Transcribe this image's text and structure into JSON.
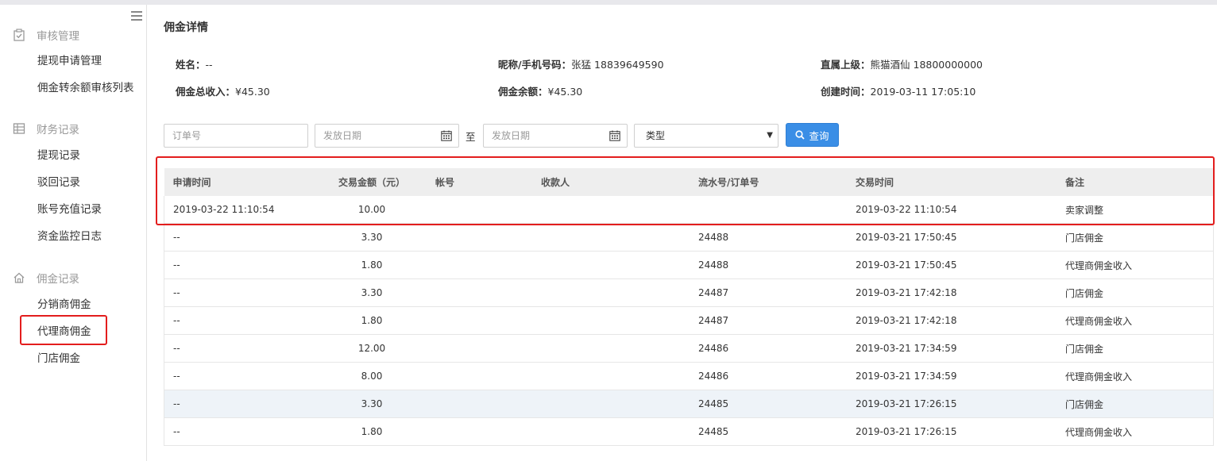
{
  "sidebar": {
    "groups": [
      {
        "title": "审核管理",
        "icon": "clipboard-check-icon",
        "items": [
          "提现申请管理",
          "佣金转余额审核列表"
        ]
      },
      {
        "title": "财务记录",
        "icon": "ledger-icon",
        "items": [
          "提现记录",
          "驳回记录",
          "账号充值记录",
          "资金监控日志"
        ]
      },
      {
        "title": "佣金记录",
        "icon": "home-icon",
        "items": [
          "分销商佣金",
          "代理商佣金",
          "门店佣金"
        ]
      }
    ],
    "active_item": "代理商佣金"
  },
  "page": {
    "title": "佣金详情"
  },
  "info": {
    "name_label": "姓名：",
    "name_value": "--",
    "nick_label": "昵称/手机号码：",
    "nick_value": "张猛  18839649590",
    "superior_label": "直属上级：",
    "superior_value": "熊猫酒仙  18800000000",
    "total_income_label": "佣金总收入：",
    "total_income_value": "¥45.30",
    "balance_label": "佣金余额：",
    "balance_value": "¥45.30",
    "created_label": "创建时间：",
    "created_value": "2019-03-11 17:05:10"
  },
  "filters": {
    "order_placeholder": "订单号",
    "start_date_placeholder": "发放日期",
    "separator": "至",
    "end_date_placeholder": "发放日期",
    "type_selected": "类型",
    "query_label": "查询"
  },
  "table": {
    "columns": [
      "申请时间",
      "交易金额（元）",
      "帐号",
      "收款人",
      "流水号/订单号",
      "交易时间",
      "备注"
    ],
    "rows": [
      [
        "2019-03-22 11:10:54",
        "10.00",
        "",
        "",
        "",
        "2019-03-22 11:10:54",
        "卖家调整"
      ],
      [
        "--",
        "3.30",
        "",
        "",
        "24488",
        "2019-03-21 17:50:45",
        "门店佣金"
      ],
      [
        "--",
        "1.80",
        "",
        "",
        "24488",
        "2019-03-21 17:50:45",
        "代理商佣金收入"
      ],
      [
        "--",
        "3.30",
        "",
        "",
        "24487",
        "2019-03-21 17:42:18",
        "门店佣金"
      ],
      [
        "--",
        "1.80",
        "",
        "",
        "24487",
        "2019-03-21 17:42:18",
        "代理商佣金收入"
      ],
      [
        "--",
        "12.00",
        "",
        "",
        "24486",
        "2019-03-21 17:34:59",
        "门店佣金"
      ],
      [
        "--",
        "8.00",
        "",
        "",
        "24486",
        "2019-03-21 17:34:59",
        "代理商佣金收入"
      ],
      [
        "--",
        "3.30",
        "",
        "",
        "24485",
        "2019-03-21 17:26:15",
        "门店佣金"
      ],
      [
        "--",
        "1.80",
        "",
        "",
        "24485",
        "2019-03-21 17:26:15",
        "代理商佣金收入"
      ]
    ],
    "highlighted_row": 7
  },
  "colors": {
    "accent": "#3a8ee6",
    "highlight_box": "#e31d1d"
  }
}
